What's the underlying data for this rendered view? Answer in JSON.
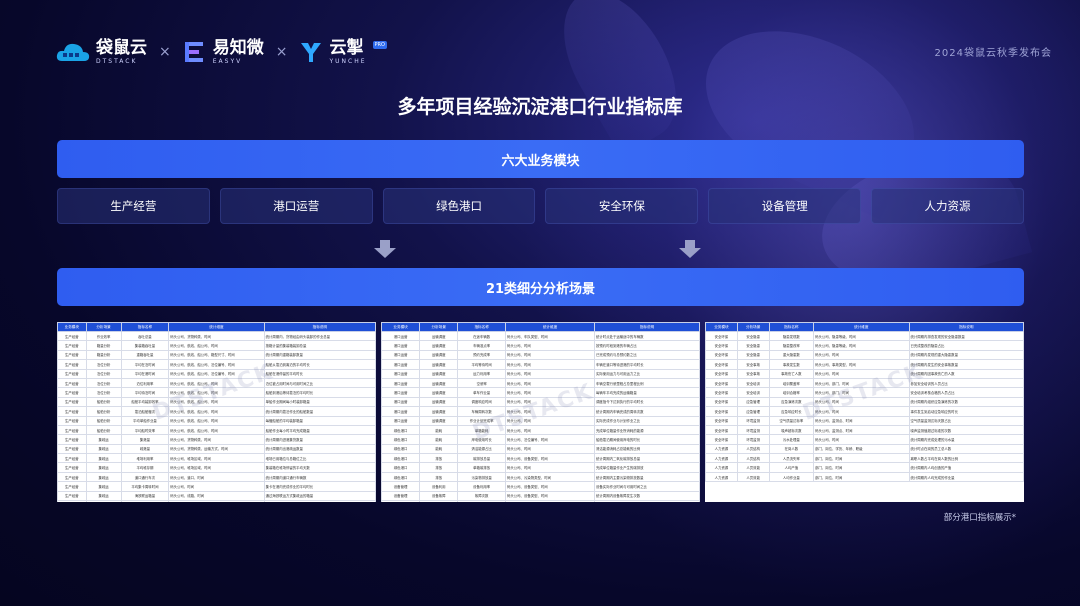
{
  "header": {
    "logos": [
      {
        "name": "袋鼠云",
        "sub": "DTSTACK"
      },
      {
        "name": "易知微",
        "sub": "EASYV"
      },
      {
        "name": "云掣",
        "sub": "YUNCHE",
        "badge": "PRO"
      }
    ],
    "separator": "×",
    "event": "2024袋鼠云秋季发布会"
  },
  "title": "多年项目经验沉淀港口行业指标库",
  "modules_bar": "六大业务模块",
  "modules": [
    "生产经营",
    "港口运营",
    "绿色港口",
    "安全环保",
    "设备管理",
    "人力资源"
  ],
  "scenarios_bar": "21类细分分析场景",
  "tables": {
    "left": {
      "headers": [
        "业务模块",
        "分析场景",
        "指标名称",
        "统计维度",
        "指标说明"
      ],
      "rows": [
        [
          "生产经营",
          "作业效率",
          "吞吐总量",
          "码头公司、货物种类、时间",
          "统计周期内，货物经由码头装卸的作业总量"
        ],
        [
          "生产经营",
          "箱量分析",
          "集装箱吞吐量",
          "码头公司、航线、船公司、时间",
          "按箱计量的集装箱装卸总量"
        ],
        [
          "生产经营",
          "箱量分析",
          "重箱吞吐量",
          "码头公司、航线、船公司、箱型尺寸、时间",
          "统计周期内重箱装卸数量"
        ],
        [
          "生产经营",
          "泊位分析",
          "平均在泊时间",
          "码头公司、航线、船公司、泊位编号、时间",
          "船舶从靠泊到离泊的平均时长"
        ],
        [
          "生产经营",
          "泊位分析",
          "平均在港时间",
          "码头公司、航线、船公司、泊位编号、时间",
          "船舶在港停留的平均时长"
        ],
        [
          "生产经营",
          "泊位分析",
          "泊位利用率",
          "码头公司、航线、船公司、时间",
          "泊位被占用时间与可用时间之比"
        ],
        [
          "生产经营",
          "泊位分析",
          "平均待泊时间",
          "码头公司、航线、船公司、时间",
          "船舶到港后等待靠泊的平均时长"
        ],
        [
          "生产经营",
          "船舶分析",
          "船舶平均装卸效率",
          "码头公司、航线、船公司、时间",
          "单船作业期间每小时装卸箱量"
        ],
        [
          "生产经营",
          "船舶分析",
          "靠泊船舶艘次",
          "码头公司、航线、船公司、时间",
          "统计周期内靠泊作业的船舶数量"
        ],
        [
          "生产经营",
          "船舶分析",
          "平均单船作业量",
          "码头公司、航线、船公司、时间",
          "每艘船舶的平均装卸箱量"
        ],
        [
          "生产经营",
          "船舶分析",
          "平均船时效率",
          "码头公司、航线、船公司、时间",
          "船舶作业每小时平均完成箱量"
        ],
        [
          "生产经营",
          "集疏运",
          "集港量",
          "码头公司、货物种类、时间",
          "统计周期内进港集货数量"
        ],
        [
          "生产经营",
          "集疏运",
          "疏港量",
          "码头公司、货物种类、运输方式、时间",
          "统计周期内出港疏运数量"
        ],
        [
          "生产经营",
          "集疏运",
          "堆场利用率",
          "码头公司、堆场区域、时间",
          "堆场已用箱位与总箱位之比"
        ],
        [
          "生产经营",
          "集疏运",
          "平均堆存期",
          "码头公司、堆场区域、时间",
          "集装箱在堆场停留的平均天数"
        ],
        [
          "生产经营",
          "集疏运",
          "道口通行车次",
          "码头公司、道口、时间",
          "统计周期内道口通行车辆数"
        ],
        [
          "生产经营",
          "集疏运",
          "平均集卡周转时间",
          "码头公司、时间",
          "集卡在港内完成作业的平均时长"
        ],
        [
          "生产经营",
          "集疏运",
          "海铁联运箱量",
          "码头公司、线路、时间",
          "通过海铁联运方式集疏运的箱量"
        ],
        [
          "生产经营",
          "集疏运",
          "水水中转箱量",
          "码头公司、航线、时间",
          "经水路中转的集装箱数量"
        ]
      ]
    },
    "middle": {
      "headers": [
        "业务模块",
        "分析场景",
        "指标名称",
        "统计维度",
        "指标说明"
      ],
      "rows": [
        [
          "港口运营",
          "运输调度",
          "在途车辆数",
          "码头公司、车队类型、时间",
          "统计时点处于运输途中的车辆数"
        ],
        [
          "港口运营",
          "运输调度",
          "车辆准点率",
          "码头公司、时间",
          "按预约时段到港的车辆占比"
        ],
        [
          "港口运营",
          "运输调度",
          "预约完成率",
          "码头公司、时间",
          "已完成预约与总预约数之比"
        ],
        [
          "港口运营",
          "运输调度",
          "平均等待时间",
          "码头公司、时间",
          "车辆在道口等待进港的平均时长"
        ],
        [
          "港口运营",
          "运输调度",
          "运力利用率",
          "码头公司、时间",
          "实际使用运力与可用运力之比"
        ],
        [
          "港口运营",
          "运输调度",
          "空驶率",
          "码头公司、时间",
          "车辆空载行驶里程占总里程比例"
        ],
        [
          "港口运营",
          "运输调度",
          "单车作业量",
          "码头公司、时间",
          "每辆车平均完成的运输箱量"
        ],
        [
          "港口运营",
          "运输调度",
          "调度响应时间",
          "码头公司、时间",
          "调度指令下达到执行的平均时长"
        ],
        [
          "港口运营",
          "运输调度",
          "车辆周转次数",
          "码头公司、时间",
          "统计周期内车辆完成的周转次数"
        ],
        [
          "港口运营",
          "运输调度",
          "作业计划完成率",
          "码头公司、时间",
          "实际完成作业与计划作业之比"
        ],
        [
          "绿色港口",
          "能耗",
          "单箱能耗",
          "码头公司、时间",
          "完成单位箱量作业所消耗的能源"
        ],
        [
          "绿色港口",
          "能耗",
          "岸电使用时长",
          "码头公司、泊位编号、时间",
          "船舶靠泊期间使用岸电的时长"
        ],
        [
          "绿色港口",
          "能耗",
          "清洁能源占比",
          "码头公司、时间",
          "清洁能源消耗占总能耗的比例"
        ],
        [
          "绿色港口",
          "排放",
          "碳排放总量",
          "码头公司、设备类型、时间",
          "统计周期内二氧化碳排放总量"
        ],
        [
          "绿色港口",
          "排放",
          "单箱碳排放",
          "码头公司、时间",
          "完成单位箱量作业产生的碳排放"
        ],
        [
          "绿色港口",
          "排放",
          "污染物排放量",
          "码头公司、污染物类型、时间",
          "统计周期内主要污染物排放数量"
        ],
        [
          "设备管理",
          "设备利用",
          "设备利用率",
          "码头公司、设备类型、时间",
          "设备实际作业时间与可用时间之比"
        ],
        [
          "设备管理",
          "设备故障",
          "故障次数",
          "码头公司、设备类型、时间",
          "统计周期内设备故障发生次数"
        ],
        [
          "设备管理",
          "设备维修",
          "平均维修时长",
          "码头公司、设备类型、时间",
          "设备故障后恢复正常的平均时长"
        ]
      ]
    },
    "right": {
      "headers": [
        "业务模块",
        "分析场景",
        "指标名称",
        "统计维度",
        "指标说明"
      ],
      "rows": [
        [
          "安全环保",
          "安全隐患",
          "隐患发现数",
          "码头公司、隐患等级、时间",
          "统计周期内排查发现的安全隐患数量"
        ],
        [
          "安全环保",
          "安全隐患",
          "隐患整改率",
          "码头公司、隐患等级、时间",
          "已完成整改的隐患占比"
        ],
        [
          "安全环保",
          "安全隐患",
          "重大隐患数",
          "码头公司、时间",
          "统计周期内发现的重大隐患数量"
        ],
        [
          "安全环保",
          "安全事故",
          "事故发生数",
          "码头公司、事故类型、时间",
          "统计周期内发生的安全事故数量"
        ],
        [
          "安全环保",
          "安全事故",
          "事故伤亡人数",
          "码头公司、时间",
          "统计周期内因事故伤亡的人数"
        ],
        [
          "安全环保",
          "安全培训",
          "培训覆盖率",
          "码头公司、部门、时间",
          "参加安全培训的人员占比"
        ],
        [
          "安全环保",
          "安全培训",
          "培训合格率",
          "码头公司、部门、时间",
          "安全培训考核合格的人员占比"
        ],
        [
          "安全环保",
          "应急管理",
          "应急演练次数",
          "码头公司、时间",
          "统计周期内组织应急演练的次数"
        ],
        [
          "安全环保",
          "应急管理",
          "应急响应时长",
          "码头公司、时间",
          "事件发生到启动应急响应的时长"
        ],
        [
          "安全环保",
          "环境监测",
          "空气质量达标率",
          "码头公司、监测点、时间",
          "空气质量监测达标天数占比"
        ],
        [
          "安全环保",
          "环境监测",
          "噪声超标次数",
          "码头公司、监测点、时间",
          "噪声监测值超过标准的次数"
        ],
        [
          "安全环保",
          "环境监测",
          "污水处理量",
          "码头公司、时间",
          "统计周期内完成处理的污水量"
        ],
        [
          "人力资源",
          "人员结构",
          "在岗人数",
          "部门、岗位、学历、年龄、职级",
          "统计时点在岗的员工总人数"
        ],
        [
          "人力资源",
          "人员结构",
          "人员流失率",
          "部门、岗位、时间",
          "离职人数占平均在岗人数的比例"
        ],
        [
          "人力资源",
          "人员效能",
          "人均产值",
          "部门、岗位、时间",
          "统计周期内人均创造的产值"
        ],
        [
          "人力资源",
          "人员效能",
          "人均作业量",
          "部门、岗位、时间",
          "统计周期内人均完成的作业量"
        ]
      ]
    }
  },
  "watermark": "DTSTACK",
  "caption": "部分港口指标展示*"
}
